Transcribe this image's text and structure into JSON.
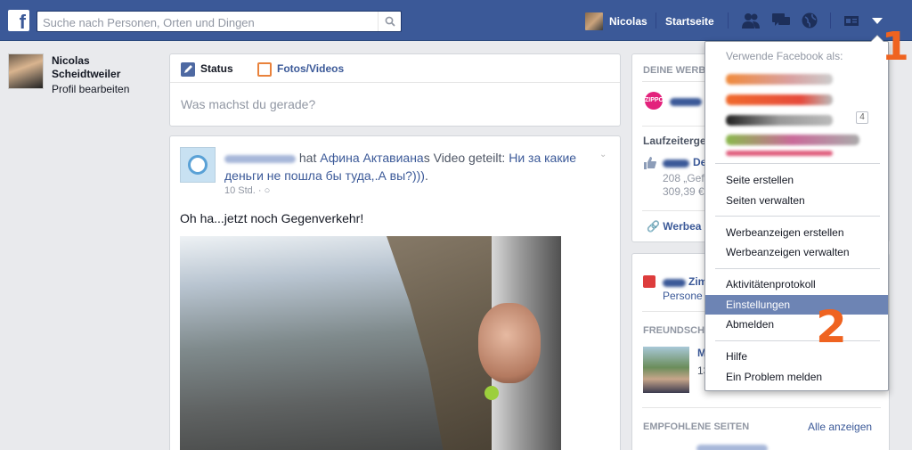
{
  "topbar": {
    "logo": "f",
    "search_placeholder": "Suche nach Personen, Orten und Dingen",
    "user_name": "Nicolas",
    "home_label": "Startseite"
  },
  "left": {
    "name": "Nicolas Scheidtweiler",
    "edit_profile": "Profil bearbeiten"
  },
  "composer": {
    "tab_status": "Status",
    "tab_photo": "Fotos/Videos",
    "placeholder": "Was machst du gerade?"
  },
  "post": {
    "hat": "hat",
    "shared_from": "Афина Актавиана",
    "shared_suffix": "s Video geteilt:",
    "video_title": "Ни за какие деньги не пошла бы туда,.А вы?)))",
    "video_title_end": ".",
    "time": "10 Std.",
    "text": "Oh ha...jetzt noch Gegenverkehr!"
  },
  "right_card1": {
    "ads_title": "DEINE WERBE",
    "logo_text": "ZIPPO",
    "running_ads": "Laufzeitergeb",
    "ad_title": "De",
    "ad_line1": "208 „Gef",
    "ad_line2": "309,39 €",
    "ads_link": "Werbea"
  },
  "right_card2": {
    "birthday_name": "Zim",
    "birthday_sub": "Persone",
    "friends_title": "FREUNDSCHA",
    "friend_initial": "M",
    "friend_line": "13",
    "recommended_title": "EMPFOHLENE SEITEN",
    "see_all": "Alle anzeigen"
  },
  "dropdown": {
    "header": "Verwende Facebook als:",
    "pages_count": "4",
    "groups": [
      [
        "Seite erstellen",
        "Seiten verwalten"
      ],
      [
        "Werbeanzeigen erstellen",
        "Werbeanzeigen verwalten"
      ],
      [
        "Aktivitätenprotokoll",
        "Einstellungen",
        "Abmelden"
      ],
      [
        "Hilfe",
        "Ein Problem melden"
      ]
    ],
    "selected_item": "Einstellungen"
  },
  "annotations": {
    "step1": "1",
    "step2": "2",
    "color": "#ef6320"
  },
  "colors": {
    "brand": "#3b5998",
    "selected": "#6d84b4",
    "background": "#e9eaed"
  }
}
